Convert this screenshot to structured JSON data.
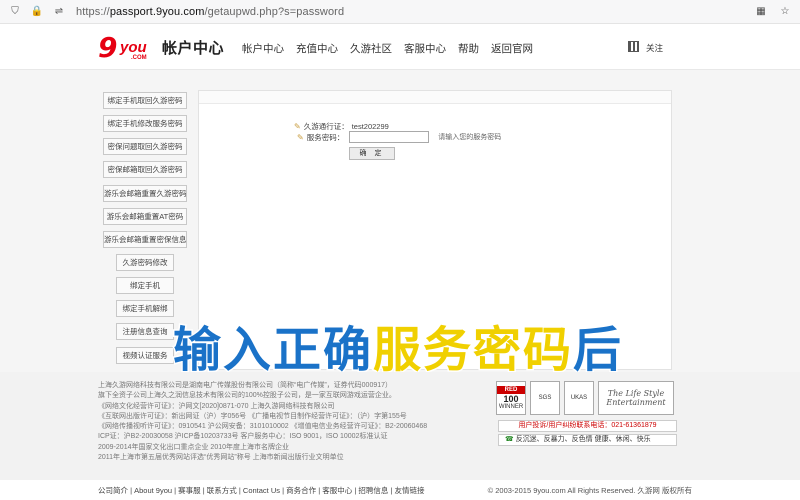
{
  "browser": {
    "url_prefix": "https://",
    "url_host": "passport.9you.com",
    "url_path": "/getaupwd.php?s=password"
  },
  "header": {
    "logo_nine": "9",
    "logo_you": "you",
    "logo_com": ".COM",
    "site_title": "帐户中心",
    "nav": [
      "帐户中心",
      "充值中心",
      "久游社区",
      "客服中心",
      "帮助",
      "返回官网"
    ],
    "follow": "关注"
  },
  "sidebar": {
    "items": [
      "绑定手机取回久游密码",
      "绑定手机修改服务密码",
      "密保问题取回久游密码",
      "密保邮箱取回久游密码",
      "游乐会邮箱重置久游密码",
      "游乐会邮箱重置AT密码",
      "游乐会邮箱重置密保信息",
      "久游密码修改",
      "绑定手机",
      "绑定手机解绑",
      "注册信息查询",
      "视频认证服务"
    ]
  },
  "form": {
    "account_label": "久游通行证：",
    "account_value": "test202299",
    "pwd_label": "服务密码：",
    "pwd_value": "",
    "hint": "请输入您的服务密码",
    "confirm": "确 定"
  },
  "caption": {
    "part1": "输入正确",
    "part2": "服务密码",
    "part3": "后"
  },
  "footer": {
    "lines": [
      "上海久游网络科技有限公司是湖南电广传媒股份有限公司（简称“电广传媒”，证券代码000917）",
      "旗下全资子公司上海久之润信息技术有限公司的100%控股子公司，是一家互联网游戏运营企业。",
      "《网络文化经营许可证》：沪网文[2020]0871-070   上海久游网络科技有限公司",
      "《互联网出版许可证》：新出网证（沪）字056号   《广播电视节目制作经营许可证》：（沪）字第155号",
      "《网络传播视听许可证》：0910541   沪公网安备：3101010002   《增值电信业务经营许可证》：B2-20060468",
      "ICP证：沪B2-20030058   沪ICP备10203733号   客户服务中心：ISO 9001，ISO 10002标准认证",
      "2009-2014年国家文化出口重点企业   2010年度上海市名牌企业",
      "2011年上海市第五届优秀网站评选“优秀网站”称号   上海市新闻出版行业文明单位"
    ],
    "badge1_top": "RED",
    "badge1_num": "100",
    "badge1_bottom": "WINNER",
    "badge2": "SGS",
    "badge3": "UKAS",
    "badge4": "The Life Style Entertainment",
    "phone": "用户投诉/用户纠纷联系电话：021-61361879",
    "report_icon": "☎",
    "report": "反沉迷、反暴力、反色情   健康、休闲、快乐",
    "bottom_links": "公司简介 | About 9you | 赛事服 | 联系方式 | Contact Us | 商务合作 | 客服中心 | 招聘信息 | 友情链接",
    "copyright": "© 2003-2015 9you.com All Rights Reserved. 久游网 版权所有"
  }
}
